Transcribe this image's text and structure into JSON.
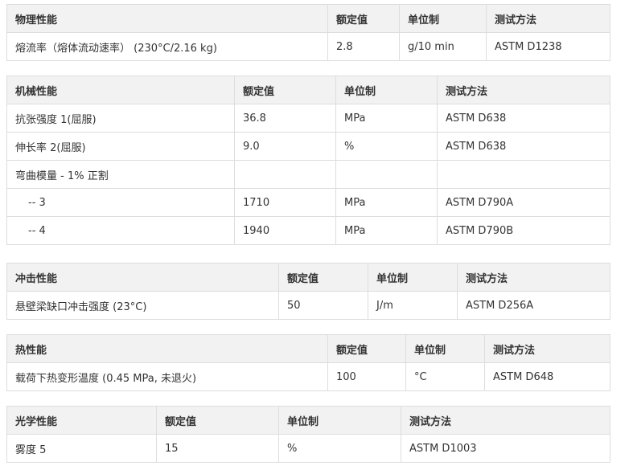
{
  "tables": [
    {
      "header": [
        "物理性能",
        "额定值",
        "单位制",
        "测试方法"
      ],
      "rows": [
        [
          "熔流率（熔体流动速率） (230°C/2.16 kg)",
          "2.8",
          "g/10 min",
          "ASTM D1238"
        ]
      ]
    },
    {
      "header": [
        "机械性能",
        "额定值",
        "单位制",
        "测试方法"
      ],
      "rows": [
        [
          "抗张强度 1(屈服)",
          "36.8",
          "MPa",
          "ASTM D638"
        ],
        [
          "伸长率 2(屈服)",
          "9.0",
          "%",
          "ASTM D638"
        ],
        [
          "弯曲模量 - 1% 正割",
          "",
          "",
          ""
        ],
        [
          "-- 3",
          "1710",
          "MPa",
          "ASTM D790A"
        ],
        [
          "-- 4",
          "1940",
          "MPa",
          "ASTM D790B"
        ]
      ]
    },
    {
      "header": [
        "冲击性能",
        "额定值",
        "单位制",
        "测试方法"
      ],
      "rows": [
        [
          "悬壁梁缺口冲击强度 (23°C)",
          "50",
          "J/m",
          "ASTM D256A"
        ]
      ]
    },
    {
      "header": [
        "热性能",
        "额定值",
        "单位制",
        "测试方法"
      ],
      "rows": [
        [
          "载荷下热变形温度 (0.45 MPa, 未退火)",
          "100",
          "°C",
          "ASTM D648"
        ]
      ]
    },
    {
      "header": [
        "光学性能",
        "额定值",
        "单位制",
        "测试方法"
      ],
      "rows": [
        [
          "雾度 5",
          "15",
          "%",
          "ASTM D1003"
        ]
      ]
    }
  ]
}
